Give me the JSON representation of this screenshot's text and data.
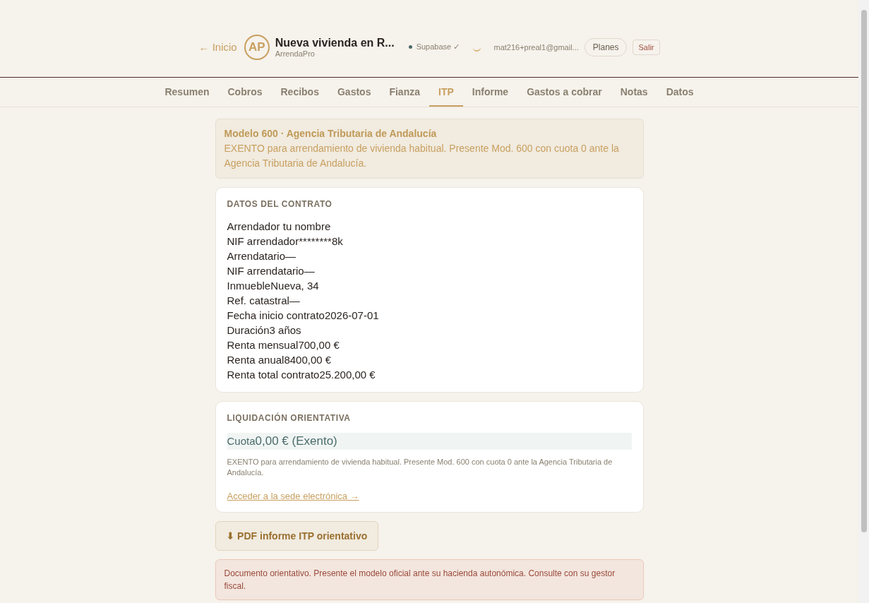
{
  "header": {
    "back_link": "← Inicio",
    "avatar": "AP",
    "title": "Nueva vivienda en R...",
    "subtitle": "ArrendaPro",
    "sync_status": {
      "label": "Supabase ✓",
      "color": "#4a6a6a"
    },
    "email": "mat216+preal1@gmail...",
    "plans_button": "Planes",
    "logout_button": "Salir"
  },
  "tabs": [
    {
      "label": "Resumen",
      "selected": false
    },
    {
      "label": "Cobros",
      "selected": false
    },
    {
      "label": "Recibos",
      "selected": false
    },
    {
      "label": "Gastos",
      "selected": false
    },
    {
      "label": "Fianza",
      "selected": false
    },
    {
      "label": "ITP",
      "selected": true
    },
    {
      "label": "Informe",
      "selected": false
    },
    {
      "label": "Gastos a cobrar",
      "selected": false
    },
    {
      "label": "Notas",
      "selected": false
    },
    {
      "label": "Datos",
      "selected": false
    }
  ],
  "notice": {
    "title": "Modelo 600 · Agencia Tributaria de Andalucía",
    "text": "EXENTO para arrendamiento de vivienda habitual. Presente Mod. 600 con cuota 0 ante la Agencia Tributaria de Andalucía."
  },
  "contract": {
    "heading": "DATOS DEL CONTRATO",
    "rows": [
      "Arrendador tu nombre",
      "NIF arrendador********8k",
      "Arrendatario—",
      "NIF arrendatario—",
      "InmuebleNueva, 34",
      "Ref. catastral—",
      "Fecha inicio contrato2026-07-01",
      "Duración3 años",
      "Renta mensual700,00 €",
      "Renta anual8400,00 €",
      "Renta total contrato25.200,00 €"
    ]
  },
  "liquidation": {
    "heading": "LIQUIDACIÓN ORIENTATIVA",
    "fee_label": "Cuota",
    "fee_value": "0,00 € (Exento)",
    "note": "EXENTO para arrendamiento de vivienda habitual. Presente Mod. 600 con cuota 0 ante la Agencia Tributaria de Andalucía.",
    "link": "Acceder a la sede electrónica →"
  },
  "pdf_button": "⬇ PDF informe ITP orientativo",
  "disclaimer": "Documento orientativo. Presente el modelo oficial ante su hacienda autonómica. Consulte con su gestor fiscal."
}
